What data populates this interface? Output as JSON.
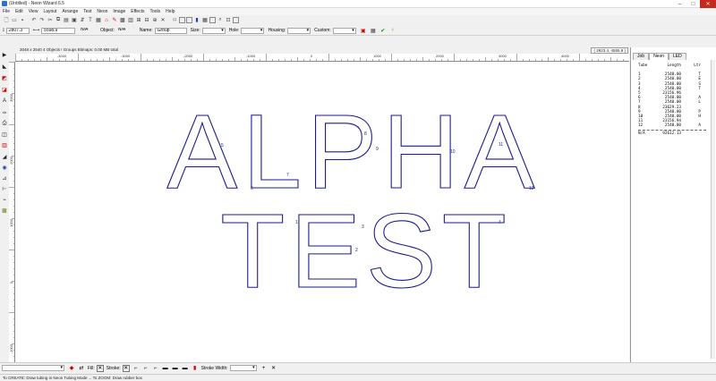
{
  "window": {
    "title": "(Untitled) - Neon Wizard 6.5",
    "controls": [
      "minimize",
      "maximize",
      "close"
    ]
  },
  "menu": [
    "File",
    "Edit",
    "View",
    "Layout",
    "Arrange",
    "Test",
    "Neon",
    "Image",
    "Effects",
    "Tools",
    "Help"
  ],
  "propbar": {
    "x_value": "2807.3",
    "w_value": "5598.9",
    "na1": "N/A",
    "object_label": "Object:",
    "object_value": "N/A",
    "name_label": "Name:",
    "name_value": "Group",
    "size_label": "Size:",
    "hole_label": "Hole:",
    "housing_label": "Housing:",
    "custom_label": "Custom:"
  },
  "info": {
    "summary": "3048 x 2540    4 Objects    ! Groups    Bitmaps: 0.00 MB total",
    "coords": "( 2923.4, 4555.9 )"
  },
  "ruler": {
    "top_labels": [
      "-4000",
      "-3000",
      "-2000",
      "-1000",
      "0",
      "1000",
      "2000",
      "3000",
      "4000"
    ],
    "left_labels": [
      "3000",
      "2000",
      "1000",
      "0",
      "-1000",
      "-2000",
      "-3000"
    ]
  },
  "canvas": {
    "word1": "ALPHA",
    "word2": "TEST",
    "tube_markers": [
      "1",
      "2",
      "3",
      "4",
      "5",
      "6",
      "7",
      "8",
      "9",
      "10",
      "11",
      "12"
    ]
  },
  "panel": {
    "tabs": [
      "Job",
      "Neon",
      "LED"
    ],
    "active_tab": "Neon",
    "headers": {
      "tube": "Tube",
      "length": "Length",
      "ltr": "Ltr"
    },
    "rows": [
      {
        "tube": "1",
        "length": "2540.00",
        "ltr": "T"
      },
      {
        "tube": "2",
        "length": "2540.00",
        "ltr": "E"
      },
      {
        "tube": "3",
        "length": "2540.00",
        "ltr": "S"
      },
      {
        "tube": "4",
        "length": "2540.00",
        "ltr": "T"
      },
      {
        "tube": "5",
        "length": "23156.96",
        "ltr": ""
      },
      {
        "tube": "6",
        "length": "2540.00",
        "ltr": "A"
      },
      {
        "tube": "7",
        "length": "2540.00",
        "ltr": "L"
      },
      {
        "tube": "8",
        "length": "23629.23",
        "ltr": ""
      },
      {
        "tube": "9",
        "length": "2540.00",
        "ltr": "P"
      },
      {
        "tube": "10",
        "length": "2540.00",
        "ltr": "H"
      },
      {
        "tube": "11",
        "length": "23156.94",
        "ltr": ""
      },
      {
        "tube": "12",
        "length": "2540.00",
        "ltr": "A"
      }
    ],
    "total": {
      "tube": "N/A",
      "length": "92612.13"
    }
  },
  "bottombar": {
    "fill_label": "Fill:",
    "stroke_label": "Stroke:",
    "stroke_width_label": "Stroke Width:"
  },
  "status": "To CREATE: Draw tubing in Neon Tubing Mode ... To ZOOM: Draw rubber box",
  "colors": {
    "tube_stroke": "#1a1a8c",
    "marker": "#1a1a8c"
  }
}
